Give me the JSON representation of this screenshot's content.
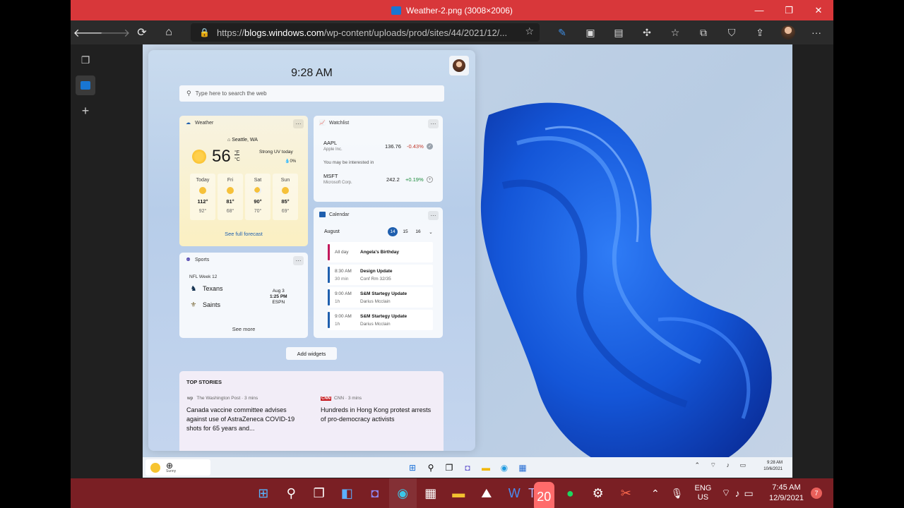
{
  "window": {
    "title": "Weather-2.png (3008×2006)",
    "minimize": "—",
    "maximize": "❐",
    "close": "✕"
  },
  "browser": {
    "url_prefix": "https://",
    "url_host": "blogs.windows.com",
    "url_path": "/wp-content/uploads/prod/sites/44/2021/12/..."
  },
  "widgets": {
    "time": "9:28 AM",
    "search_placeholder": "Type here to search the web",
    "add_widgets": "Add widgets",
    "weather": {
      "title": "Weather",
      "location": "Seattle, WA",
      "temp": "56",
      "unit_f": "°F",
      "unit_c": "°C",
      "condition": "Strong UV today",
      "precip": "0%",
      "forecast": [
        {
          "day": "Today",
          "hi": "112°",
          "lo": "92°"
        },
        {
          "day": "Fri",
          "hi": "81°",
          "lo": "68°"
        },
        {
          "day": "Sat",
          "hi": "90°",
          "lo": "70°"
        },
        {
          "day": "Sun",
          "hi": "85°",
          "lo": "69°"
        }
      ],
      "link": "See full forecast"
    },
    "watchlist": {
      "title": "Watchlist",
      "stocks": [
        {
          "symbol": "AAPL",
          "name": "Apple Inc.",
          "price": "136.76",
          "change": "-0.43%"
        },
        {
          "symbol": "MSFT",
          "name": "Microsoft Corp.",
          "price": "242.2",
          "change": "+0.19%"
        }
      ],
      "suggestion": "You may be interested in"
    },
    "calendar": {
      "title": "Calendar",
      "month": "August",
      "days": [
        "14",
        "15",
        "16"
      ],
      "events": [
        {
          "time": "All day",
          "duration": "",
          "name": "Angela's Birthday",
          "detail": "",
          "color": "#c2185b"
        },
        {
          "time": "8:30 AM",
          "duration": "30 min",
          "name": "Design Update",
          "detail": "Conf Rm 32/35",
          "color": "#1f5fae"
        },
        {
          "time": "9:00 AM",
          "duration": "1h",
          "name": "S&M Startegy Update",
          "detail": "Darius Mcclain",
          "color": "#1f5fae"
        },
        {
          "time": "9:00 AM",
          "duration": "1h",
          "name": "S&M Startegy Update",
          "detail": "Darius Mcclain",
          "color": "#1f5fae"
        }
      ]
    },
    "sports": {
      "title": "Sports",
      "league": "NFL Week 12",
      "team1": "Texans",
      "team2": "Saints",
      "date": "Aug 3",
      "time": "1:25 PM",
      "network": "ESPN",
      "more": "See more"
    },
    "stories": {
      "title": "TOP STORIES",
      "items": [
        {
          "logo": "wp",
          "source": "The Washington Post · 3 mins",
          "headline": "Canada vaccine committee advises against use of AstraZeneca COVID-19 shots for 65 years and..."
        },
        {
          "logo": "CNN",
          "source": "CNN · 3 mins",
          "headline": "Hundreds in Hong Kong protest arrests of pro-democracy activists"
        }
      ]
    }
  },
  "inner_taskbar": {
    "weather_label": "Sunny",
    "time": "9:28 AM",
    "date": "10/6/2021"
  },
  "host_taskbar": {
    "lang_1": "ENG",
    "lang_2": "US",
    "time": "7:45 AM",
    "date": "12/9/2021",
    "notifications": "7",
    "teams_badge": "20"
  }
}
